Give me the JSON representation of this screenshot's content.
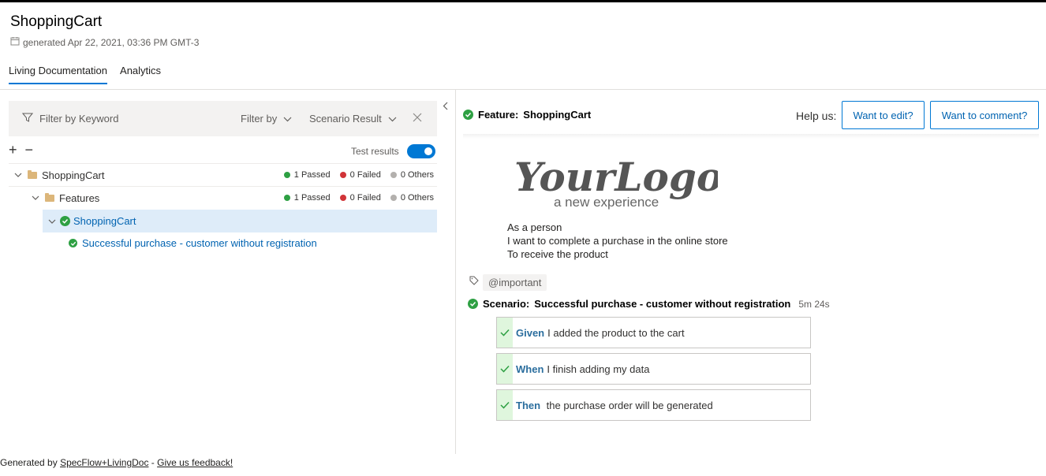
{
  "app": {
    "title": "ShoppingCart",
    "generated": "generated Apr 22, 2021, 03:36 PM GMT-3"
  },
  "tabs": [
    {
      "label": "Living Documentation",
      "active": true
    },
    {
      "label": "Analytics",
      "active": false
    }
  ],
  "filters": {
    "keyword_placeholder": "Filter by Keyword",
    "filter_by": "Filter by",
    "scenario_result": "Scenario Result"
  },
  "tree_tools": {
    "expand": "+",
    "collapse": "−",
    "test_results_label": "Test results",
    "test_results_on": true
  },
  "tree": [
    {
      "label": "ShoppingCart",
      "type": "folder",
      "passed": "1 Passed",
      "failed": "0 Failed",
      "others": "0 Others"
    },
    {
      "label": "Features",
      "type": "folder",
      "passed": "1 Passed",
      "failed": "0 Failed",
      "others": "0 Others"
    },
    {
      "label": "ShoppingCart",
      "type": "feature",
      "selected": true
    },
    {
      "label": "Successful purchase - customer without registration",
      "type": "scenario"
    }
  ],
  "feature": {
    "prefix": "Feature:",
    "name": "ShoppingCart",
    "help_label": "Help us:",
    "edit_button": "Want to edit?",
    "comment_button": "Want to comment?",
    "logo_text": "YourLogo",
    "logo_tagline": "a new experience",
    "description": [
      "As a person",
      "I want to complete a purchase in the online store",
      "To receive the product"
    ],
    "tag": "@important"
  },
  "scenario": {
    "prefix": "Scenario:",
    "name": "Successful purchase - customer without registration",
    "duration": "5m 24s",
    "steps": [
      {
        "keyword": "Given",
        "text": "I added the product to the cart"
      },
      {
        "keyword": "When",
        "text": "I finish adding my data"
      },
      {
        "keyword": "Then",
        "text": " the purchase order will be generated"
      }
    ]
  },
  "footer": {
    "prefix": "Generated by ",
    "product_link": "SpecFlow+LivingDoc",
    "separator": " - ",
    "feedback_link": "Give us feedback!"
  },
  "colors": {
    "accent": "#0078d4",
    "passed": "#2ea043",
    "failed": "#d13438",
    "others": "#b3b0ad"
  }
}
